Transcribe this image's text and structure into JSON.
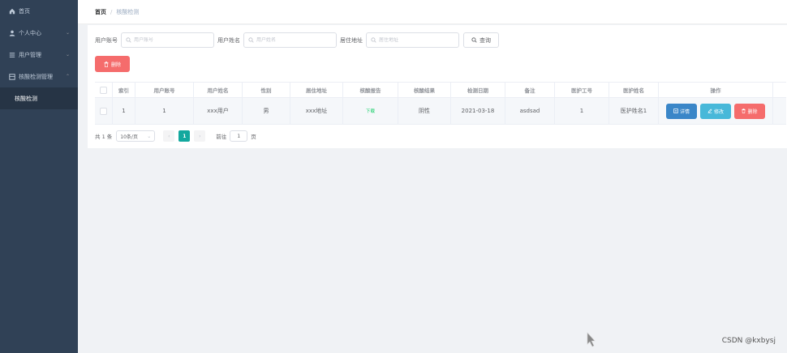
{
  "sidebar": {
    "items": [
      {
        "icon": "home-icon",
        "label": "首页"
      },
      {
        "icon": "user-icon",
        "label": "个人中心",
        "arrow": "chevron-down-icon"
      },
      {
        "icon": "list-icon",
        "label": "用户管理",
        "arrow": "chevron-down-icon"
      },
      {
        "icon": "grid-icon",
        "label": "核酸检测管理",
        "arrow": "chevron-up-icon"
      }
    ],
    "submenu": [
      {
        "label": "核酸检测"
      }
    ]
  },
  "breadcrumb": {
    "home": "首页",
    "separator": "/",
    "current": "核酸检测"
  },
  "search": {
    "account_label": "用户账号",
    "account_placeholder": "用户账号",
    "name_label": "用户姓名",
    "name_placeholder": "用户姓名",
    "address_label": "居住地址",
    "address_placeholder": "居住地址",
    "query_label": "查询"
  },
  "toolbar": {
    "delete_label": "删除"
  },
  "table": {
    "headers": [
      "索引",
      "用户账号",
      "用户姓名",
      "性别",
      "居住地址",
      "核酸报告",
      "核酸结果",
      "检测日期",
      "备注",
      "医护工号",
      "医护姓名",
      "操作"
    ],
    "rows": [
      {
        "index": "1",
        "account": "1",
        "name": "xxx用户",
        "gender": "男",
        "address": "xxx地址",
        "report": "下载",
        "result": "阴性",
        "date": "2021-03-18",
        "remark": "asdsad",
        "staff_id": "1",
        "staff_name": "医护姓名1",
        "actions": {
          "detail": "详情",
          "edit": "修改",
          "delete": "删除"
        }
      }
    ]
  },
  "pagination": {
    "total": "共 1 条",
    "page_size": "10条/页",
    "current_page": "1",
    "goto_prefix": "前往",
    "goto_value": "1",
    "goto_suffix": "页"
  },
  "watermark": "CSDN @kxbysj",
  "colors": {
    "sidebar_bg": "#304156",
    "danger": "#f56c6c",
    "primary": "#3a86c8",
    "info": "#47b8d9",
    "page_active": "#13a89e",
    "success_text": "#13ce66"
  }
}
